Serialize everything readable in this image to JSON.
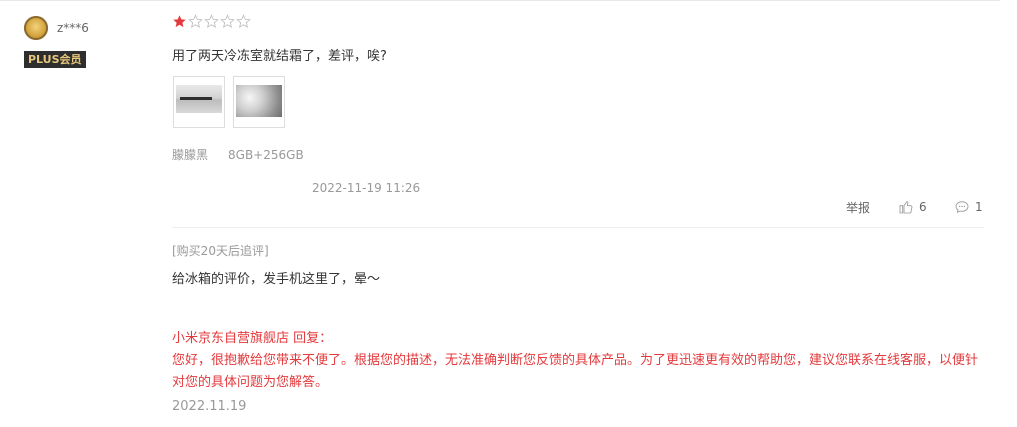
{
  "user": {
    "name": "z***6",
    "badge": "PLUS会员"
  },
  "review": {
    "rating": 1,
    "max_rating": 5,
    "content": "用了两天冷冻室就结霜了，差评，唉?",
    "images": [
      "photo-fridge-interior-1",
      "photo-fridge-frost-2"
    ],
    "color": "朦朦黑",
    "spec": "8GB+256GB",
    "time": "2022-11-19 11:26",
    "report_label": "举报",
    "like_count": "6",
    "comment_count": "1",
    "follow_up_tag": "[购买20天后追评]",
    "follow_up_text": "给冰箱的评价，发手机这里了，晕～",
    "reply_header": "小米京东自营旗舰店 回复：",
    "reply_body": "您好，很抱歉给您带来不便了。根据您的描述，无法准确判断您反馈的具体产品。为了更迅速更有效的帮助您，建议您联系在线客服，以便针对您的具体问题为您解答。",
    "reply_date": "2022.11.19"
  },
  "colors": {
    "star_active": "#e4393c",
    "reply_text": "#e4393c",
    "badge_bg": "#2e2e2e",
    "badge_text": "#e7c77a"
  },
  "icons": {
    "like": "thumbs-up-icon",
    "comment": "comment-bubble-icon",
    "star": "star-icon"
  }
}
